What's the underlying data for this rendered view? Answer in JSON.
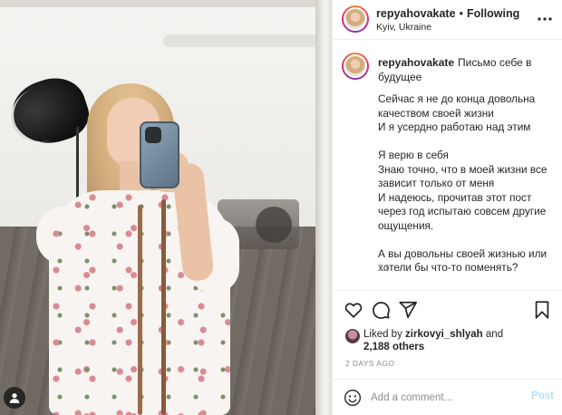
{
  "header": {
    "username": "repyahovakate",
    "separator": "•",
    "follow_status": "Following",
    "location": "Kyiv, Ukraine"
  },
  "caption": {
    "username": "repyahovakate",
    "title": "Письмо себе в будущее",
    "body": "Сейчас я не до конца довольна качеством своей жизни\nИ я усердно работаю над этим\n\nЯ верю в себя\nЗнаю точно, что в моей жизни все зависит только от меня\nИ надеюсь, прочитав этот пост через год испытаю совсем другие ощущения.\n\nА вы довольны своей жизнью или хотели бы что-то поменять?",
    "time": "2d"
  },
  "likes": {
    "prefix": "Liked by",
    "liker": "zirkovyi_shlyah",
    "and": "and",
    "others": "2,188 others"
  },
  "posted_ago": "2 DAYS AGO",
  "comment": {
    "placeholder": "Add a comment...",
    "post_label": "Post"
  },
  "icons": {
    "like": "heart-icon",
    "comment": "comment-icon",
    "share": "share-icon",
    "save": "bookmark-icon",
    "more": "more-icon",
    "emoji": "emoji-icon",
    "tag": "user-tag-icon"
  },
  "colors": {
    "post_button": "#b2dffc",
    "secondary_text": "#8e8e8e",
    "text": "#262626"
  }
}
